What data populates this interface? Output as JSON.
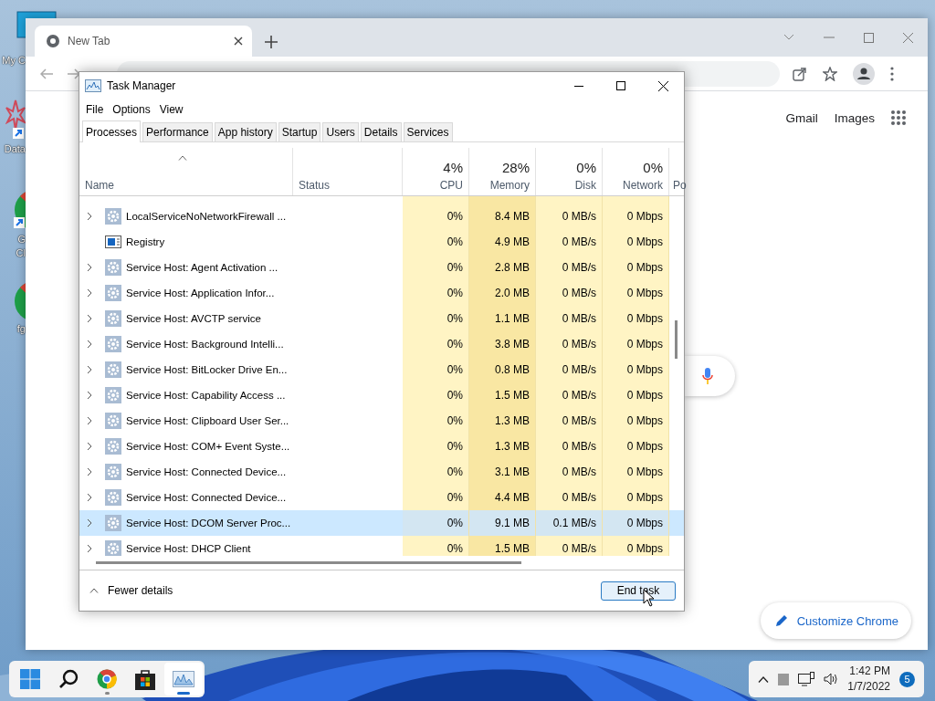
{
  "desktop": {
    "icons": [
      {
        "kind": "computer",
        "lines": [
          "My C"
        ]
      },
      {
        "kind": "app",
        "lines": [
          "Data"
        ]
      },
      {
        "kind": "chrome",
        "lines": [
          "G",
          "Cl"
        ]
      },
      {
        "kind": "chrome",
        "lines": [
          "fg"
        ]
      }
    ]
  },
  "browser": {
    "tab": {
      "title": "New Tab",
      "selected": true
    },
    "links": [
      "Gmail",
      "Images"
    ],
    "customize_button": "Customize Chrome"
  },
  "task_manager": {
    "title": "Task Manager",
    "menu": [
      "File",
      "Options",
      "View"
    ],
    "tabs": [
      {
        "label": "Processes",
        "selected": true
      },
      {
        "label": "Performance",
        "selected": false
      },
      {
        "label": "App history",
        "selected": false
      },
      {
        "label": "Startup",
        "selected": false
      },
      {
        "label": "Users",
        "selected": false
      },
      {
        "label": "Details",
        "selected": false
      },
      {
        "label": "Services",
        "selected": false
      }
    ],
    "columns": [
      {
        "kind": "name",
        "label": "Name",
        "sorted": true
      },
      {
        "kind": "text",
        "label": "Status",
        "sorted": false
      },
      {
        "kind": "metric",
        "total": "4%",
        "label": "CPU",
        "sorted": false,
        "color": "#fff4c4"
      },
      {
        "kind": "metric",
        "total": "28%",
        "label": "Memory",
        "sorted": false,
        "color": "#f9e7a3"
      },
      {
        "kind": "metric",
        "total": "0%",
        "label": "Disk",
        "sorted": false,
        "color": "#fff4c4"
      },
      {
        "kind": "metric",
        "total": "0%",
        "label": "Network",
        "sorted": false,
        "color": "#fff4c4"
      },
      {
        "kind": "text",
        "label": "Po",
        "sorted": false
      }
    ],
    "rows": [
      {
        "name": "LocalServiceNoNetworkFirewall ...",
        "kind": "service",
        "expandable": true,
        "cpu": "0%",
        "memory": "8.4 MB",
        "disk": "0 MB/s",
        "network": "0 Mbps",
        "selected": false
      },
      {
        "name": "Registry",
        "kind": "registry",
        "expandable": false,
        "cpu": "0%",
        "memory": "4.9 MB",
        "disk": "0 MB/s",
        "network": "0 Mbps",
        "selected": false
      },
      {
        "name": "Service Host: Agent Activation ...",
        "kind": "service",
        "expandable": true,
        "cpu": "0%",
        "memory": "2.8 MB",
        "disk": "0 MB/s",
        "network": "0 Mbps",
        "selected": false
      },
      {
        "name": "Service Host: Application Infor...",
        "kind": "service",
        "expandable": true,
        "cpu": "0%",
        "memory": "2.0 MB",
        "disk": "0 MB/s",
        "network": "0 Mbps",
        "selected": false
      },
      {
        "name": "Service Host: AVCTP service",
        "kind": "service",
        "expandable": true,
        "cpu": "0%",
        "memory": "1.1 MB",
        "disk": "0 MB/s",
        "network": "0 Mbps",
        "selected": false
      },
      {
        "name": "Service Host: Background Intelli...",
        "kind": "service",
        "expandable": true,
        "cpu": "0%",
        "memory": "3.8 MB",
        "disk": "0 MB/s",
        "network": "0 Mbps",
        "selected": false
      },
      {
        "name": "Service Host: BitLocker Drive En...",
        "kind": "service",
        "expandable": true,
        "cpu": "0%",
        "memory": "0.8 MB",
        "disk": "0 MB/s",
        "network": "0 Mbps",
        "selected": false
      },
      {
        "name": "Service Host: Capability Access ...",
        "kind": "service",
        "expandable": true,
        "cpu": "0%",
        "memory": "1.5 MB",
        "disk": "0 MB/s",
        "network": "0 Mbps",
        "selected": false
      },
      {
        "name": "Service Host: Clipboard User Ser...",
        "kind": "service",
        "expandable": true,
        "cpu": "0%",
        "memory": "1.3 MB",
        "disk": "0 MB/s",
        "network": "0 Mbps",
        "selected": false
      },
      {
        "name": "Service Host: COM+ Event Syste...",
        "kind": "service",
        "expandable": true,
        "cpu": "0%",
        "memory": "1.3 MB",
        "disk": "0 MB/s",
        "network": "0 Mbps",
        "selected": false
      },
      {
        "name": "Service Host: Connected Device...",
        "kind": "service",
        "expandable": true,
        "cpu": "0%",
        "memory": "3.1 MB",
        "disk": "0 MB/s",
        "network": "0 Mbps",
        "selected": false
      },
      {
        "name": "Service Host: Connected Device...",
        "kind": "service",
        "expandable": true,
        "cpu": "0%",
        "memory": "4.4 MB",
        "disk": "0 MB/s",
        "network": "0 Mbps",
        "selected": false
      },
      {
        "name": "Service Host: DCOM Server Proc...",
        "kind": "service",
        "expandable": true,
        "cpu": "0%",
        "memory": "9.1 MB",
        "disk": "0.1 MB/s",
        "network": "0 Mbps",
        "selected": true
      },
      {
        "name": "Service Host: DHCP Client",
        "kind": "service",
        "expandable": true,
        "cpu": "0%",
        "memory": "1.5 MB",
        "disk": "0 MB/s",
        "network": "0 Mbps",
        "selected": false
      }
    ],
    "fewer_details": "Fewer details",
    "end_task": "End task"
  },
  "taskbar": {
    "apps": [
      {
        "kind": "start",
        "open": false,
        "active": false
      },
      {
        "kind": "search",
        "open": false,
        "active": false
      },
      {
        "kind": "chrome",
        "open": true,
        "active": false
      },
      {
        "kind": "store",
        "open": false,
        "active": false
      },
      {
        "kind": "taskmanager",
        "open": true,
        "active": true
      }
    ],
    "tray": {
      "time": "1:42 PM",
      "date": "1/7/2022",
      "notifications": "5"
    }
  }
}
